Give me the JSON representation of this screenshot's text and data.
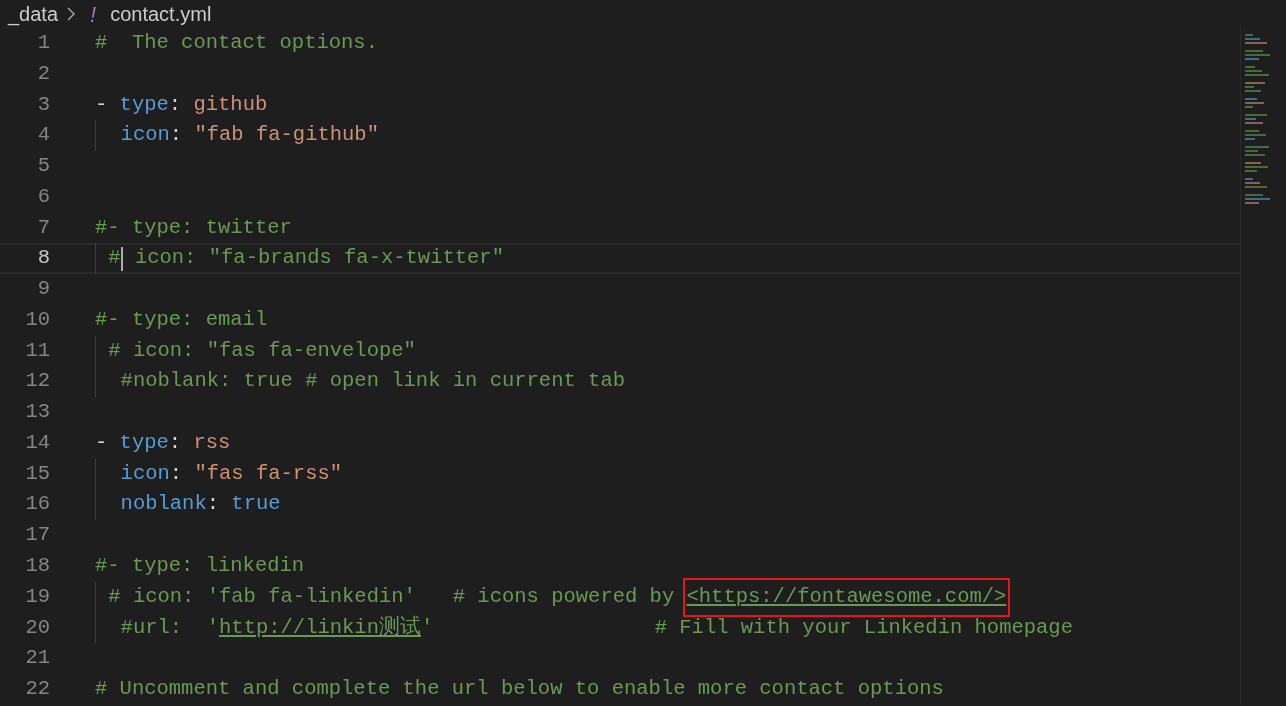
{
  "breadcrumb": {
    "folder": "_data",
    "file_icon": "!",
    "file": "contact.yml"
  },
  "lines": [
    {
      "number": "1",
      "selected": false,
      "tokens": [
        {
          "kind": "comment",
          "text": "#  The contact options."
        }
      ]
    },
    {
      "number": "2",
      "selected": false
    },
    {
      "number": "3",
      "selected": false,
      "tokens": [
        {
          "kind": "punct",
          "text": "- "
        },
        {
          "kind": "key",
          "text": "type"
        },
        {
          "kind": "punct",
          "text": ": "
        },
        {
          "kind": "string",
          "text": "github"
        }
      ]
    },
    {
      "number": "4",
      "selected": false,
      "tokens": [
        {
          "kind": "key",
          "text": "  icon"
        },
        {
          "kind": "punct",
          "text": ": "
        },
        {
          "kind": "string",
          "text": "\"fab fa-github\""
        }
      ]
    },
    {
      "number": "5",
      "selected": false
    },
    {
      "number": "6",
      "selected": false
    },
    {
      "number": "7",
      "selected": false,
      "tokens": [
        {
          "kind": "comment",
          "text": "#- type: twitter"
        }
      ]
    },
    {
      "number": "8",
      "selected": true,
      "tokens": [
        {
          "kind": "comment",
          "text": " #"
        },
        {
          "kind": "comment",
          "text": " icon: \"fa-brands fa-x-twitter\""
        }
      ]
    },
    {
      "number": "9",
      "selected": false
    },
    {
      "number": "10",
      "selected": false,
      "tokens": [
        {
          "kind": "comment",
          "text": "#- type: email"
        }
      ]
    },
    {
      "number": "11",
      "selected": false,
      "tokens": [
        {
          "kind": "comment",
          "text": " # icon: \"fas fa-envelope\""
        }
      ]
    },
    {
      "number": "12",
      "selected": false,
      "tokens": [
        {
          "kind": "comment",
          "text": "  #noblank: true # open link in current tab"
        }
      ]
    },
    {
      "number": "13",
      "selected": false
    },
    {
      "number": "14",
      "selected": false,
      "tokens": [
        {
          "kind": "punct",
          "text": "- "
        },
        {
          "kind": "key",
          "text": "type"
        },
        {
          "kind": "punct",
          "text": ": "
        },
        {
          "kind": "string",
          "text": "rss"
        }
      ]
    },
    {
      "number": "15",
      "selected": false,
      "tokens": [
        {
          "kind": "key",
          "text": "  icon"
        },
        {
          "kind": "punct",
          "text": ": "
        },
        {
          "kind": "string",
          "text": "\"fas fa-rss\""
        }
      ]
    },
    {
      "number": "16",
      "selected": false,
      "tokens": [
        {
          "kind": "key",
          "text": "  noblank"
        },
        {
          "kind": "punct",
          "text": ": "
        },
        {
          "kind": "keyword",
          "text": "true"
        }
      ]
    },
    {
      "number": "17",
      "selected": false
    },
    {
      "number": "18",
      "selected": false,
      "tokens": [
        {
          "kind": "comment",
          "text": "#- type: linkedin"
        }
      ]
    },
    {
      "number": "19",
      "selected": false,
      "tokens": [
        {
          "kind": "comment",
          "text": " # icon: 'fab fa-linkedin'   # icons powered by "
        },
        {
          "kind": "link",
          "boxed": true,
          "text": "<https://fontawesome.com/>"
        }
      ]
    },
    {
      "number": "20",
      "selected": false,
      "tokens": [
        {
          "kind": "comment",
          "text": "  #url:  '"
        },
        {
          "kind": "link",
          "boxed": false,
          "text": "http://linkin测试"
        },
        {
          "kind": "comment",
          "text": "'                  # Fill with your Linkedin homepage"
        }
      ]
    },
    {
      "number": "21",
      "selected": false
    },
    {
      "number": "22",
      "selected": false,
      "tokens": [
        {
          "kind": "comment",
          "text": "# Uncomment and complete the url below to enable more contact options"
        }
      ]
    }
  ]
}
